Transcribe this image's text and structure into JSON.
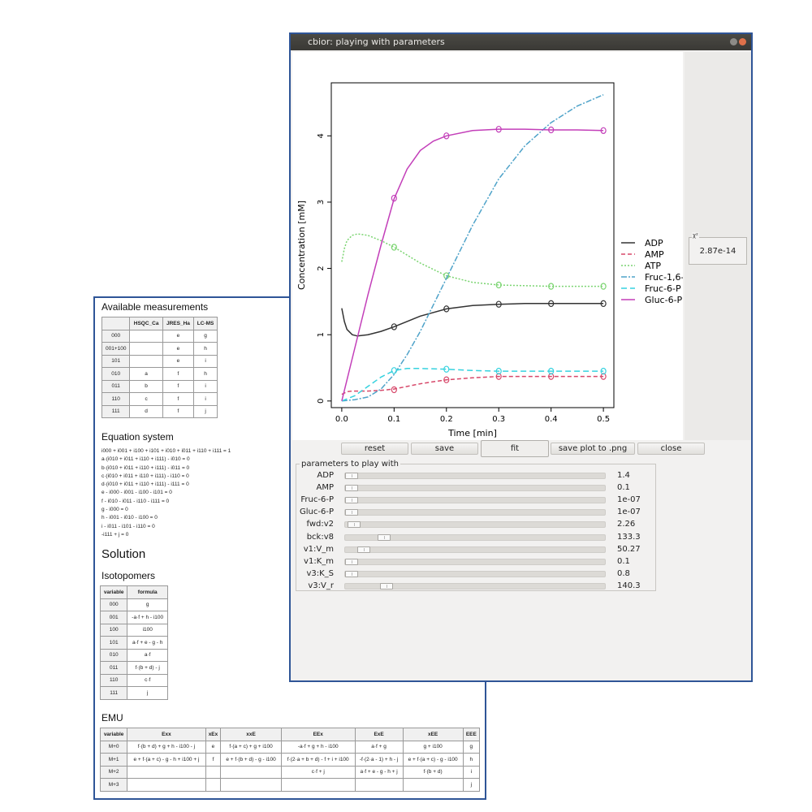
{
  "document": {
    "available_title": "Available measurements",
    "measure_headers": [
      "",
      "HSQC_Ca",
      "JRES_Ha",
      "LC-MS"
    ],
    "measure_rows": [
      [
        "000",
        "",
        "e",
        "g"
      ],
      [
        "001+100",
        "",
        "e",
        "h"
      ],
      [
        "101",
        "",
        "e",
        "i"
      ],
      [
        "010",
        "a",
        "f",
        "h"
      ],
      [
        "011",
        "b",
        "f",
        "i"
      ],
      [
        "110",
        "c",
        "f",
        "i"
      ],
      [
        "111",
        "d",
        "f",
        "j"
      ]
    ],
    "equation_title": "Equation system",
    "equations": [
      "i000 + i001 + i100 + i101 + i010 + i011 + i110 + i111 = 1",
      "a·(i010 + i011 + i110 + i111) - i010 = 0",
      "b·(i010 + i011 + i110 + i111) - i011 = 0",
      "c·(i010 + i011 + i110 + i111) - i110 = 0",
      "d·(i010 + i011 + i110 + i111) - i111 = 0",
      "e - i000 - i001 - i100 - i101 = 0",
      "f - i010 - i011 - i110 - i111 = 0",
      "g - i000 = 0",
      "h - i001 - i010 - i100 = 0",
      "i - i011 - i101 - i110 = 0",
      "-i111 + j = 0"
    ],
    "solution_title": "Solution",
    "isotopomers_title": "Isotopomers",
    "iso_headers": [
      "variable",
      "formula"
    ],
    "iso_rows": [
      [
        "000",
        "g"
      ],
      [
        "001",
        "-a·f + h - i100"
      ],
      [
        "100",
        "i100"
      ],
      [
        "101",
        "a·f + e - g - h"
      ],
      [
        "010",
        "a·f"
      ],
      [
        "011",
        "f·(b + d) - j"
      ],
      [
        "110",
        "c·f"
      ],
      [
        "111",
        "j"
      ]
    ],
    "emu_title": "EMU",
    "emu_headers": [
      "variable",
      "Exx",
      "xEx",
      "xxE",
      "EEx",
      "ExE",
      "xEE",
      "EEE"
    ],
    "emu_rows": [
      [
        "M+0",
        "f·(b + d) + g + h - i100 - j",
        "e",
        "f·(a + c) + g + i100",
        "-a·f + g + h - i100",
        "a·f + g",
        "g + i100",
        "g"
      ],
      [
        "M+1",
        "e + f·(a + c) - g - h + i100 + j",
        "f",
        "e + f·(b + d) - g - i100",
        "f·(2·a + b + d) - f + i + i100",
        "-f·(2·a - 1) + h - j",
        "e + f·(a + c) - g - i100",
        "h"
      ],
      [
        "M+2",
        "",
        "",
        "",
        "c·f + j",
        "a·f + e - g - h + j",
        "f·(b + d)",
        "i"
      ],
      [
        "M+3",
        "",
        "",
        "",
        "",
        "",
        "",
        "j"
      ]
    ]
  },
  "window": {
    "title": "cbior: playing with parameters",
    "chi_label": "χ²",
    "chi_value": "2.87e-14",
    "buttons": {
      "reset": "reset",
      "save": "save",
      "fit": "fit",
      "save_png": "save plot to .png",
      "close": "close"
    },
    "params_legend": "parameters to play with",
    "params": [
      {
        "label": "ADP",
        "value": "1.4",
        "position": 0.0
      },
      {
        "label": "AMP",
        "value": "0.1",
        "position": 0.0
      },
      {
        "label": "Fruc-6-P",
        "value": "1e-07",
        "position": 0.0
      },
      {
        "label": "Gluc-6-P",
        "value": "1e-07",
        "position": 0.0
      },
      {
        "label": "fwd:v2",
        "value": "2.26",
        "position": 0.01
      },
      {
        "label": "bck:v8",
        "value": "133.3",
        "position": 0.13
      },
      {
        "label": "v1:V_m",
        "value": "50.27",
        "position": 0.05
      },
      {
        "label": "v1:K_m",
        "value": "0.1",
        "position": 0.0
      },
      {
        "label": "v3:K_S",
        "value": "0.8",
        "position": 0.0
      },
      {
        "label": "v3:V_r",
        "value": "140.3",
        "position": 0.14
      }
    ]
  },
  "chart_data": {
    "type": "line",
    "title": "",
    "xlabel": "Time [min]",
    "ylabel": "Concentration [mM]",
    "xlim": [
      -0.02,
      0.52
    ],
    "ylim": [
      -0.1,
      4.8
    ],
    "xticks": [
      0.0,
      0.1,
      0.2,
      0.3,
      0.4,
      0.5
    ],
    "xtick_labels": [
      "0.0",
      "0.1",
      "0.2",
      "0.3",
      "0.4",
      "0.5"
    ],
    "yticks": [
      0,
      1,
      2,
      3,
      4
    ],
    "ytick_labels": [
      "0",
      "1",
      "2",
      "3",
      "4"
    ],
    "legend_position": "right",
    "series": [
      {
        "name": "ADP",
        "color": "#333333",
        "dash": "solid",
        "x": [
          0.0,
          0.005,
          0.01,
          0.02,
          0.03,
          0.05,
          0.075,
          0.1,
          0.15,
          0.2,
          0.25,
          0.3,
          0.35,
          0.4,
          0.45,
          0.5
        ],
        "y": [
          1.4,
          1.2,
          1.08,
          1.0,
          0.98,
          1.0,
          1.05,
          1.12,
          1.28,
          1.39,
          1.44,
          1.46,
          1.47,
          1.47,
          1.47,
          1.47
        ],
        "points_x": [
          0.1,
          0.2,
          0.3,
          0.4,
          0.5
        ],
        "points_y": [
          1.12,
          1.39,
          1.46,
          1.47,
          1.47
        ]
      },
      {
        "name": "AMP",
        "color": "#d7486a",
        "dash": "5,3",
        "x": [
          0.0,
          0.01,
          0.02,
          0.03,
          0.05,
          0.075,
          0.1,
          0.15,
          0.2,
          0.25,
          0.3,
          0.35,
          0.4,
          0.45,
          0.5
        ],
        "y": [
          0.1,
          0.14,
          0.15,
          0.15,
          0.15,
          0.16,
          0.18,
          0.26,
          0.32,
          0.35,
          0.37,
          0.37,
          0.37,
          0.37,
          0.37
        ],
        "points_x": [
          0.1,
          0.2,
          0.3,
          0.4,
          0.5
        ],
        "points_y": [
          0.17,
          0.32,
          0.37,
          0.37,
          0.37
        ]
      },
      {
        "name": "ATP",
        "color": "#7ad470",
        "dash": "2,2",
        "x": [
          0.0,
          0.005,
          0.01,
          0.02,
          0.03,
          0.05,
          0.075,
          0.1,
          0.15,
          0.2,
          0.25,
          0.3,
          0.35,
          0.4,
          0.45,
          0.5
        ],
        "y": [
          2.1,
          2.3,
          2.42,
          2.5,
          2.52,
          2.5,
          2.42,
          2.32,
          2.08,
          1.89,
          1.79,
          1.75,
          1.74,
          1.73,
          1.73,
          1.73
        ],
        "points_x": [
          0.1,
          0.2,
          0.3,
          0.4,
          0.5
        ],
        "points_y": [
          2.32,
          1.89,
          1.75,
          1.73,
          1.73
        ]
      },
      {
        "name": "Fruc-1,6-",
        "color": "#4fa3c9",
        "dash": "7,2,2,2",
        "x": [
          0.0,
          0.025,
          0.05,
          0.075,
          0.1,
          0.125,
          0.15,
          0.2,
          0.25,
          0.3,
          0.35,
          0.4,
          0.45,
          0.5
        ],
        "y": [
          0.0,
          0.02,
          0.06,
          0.18,
          0.4,
          0.7,
          1.05,
          1.85,
          2.65,
          3.35,
          3.85,
          4.2,
          4.45,
          4.62
        ],
        "points_x": [],
        "points_y": []
      },
      {
        "name": "Fruc-6-P",
        "color": "#36d2df",
        "dash": "7,4",
        "x": [
          0.0,
          0.025,
          0.05,
          0.075,
          0.1,
          0.125,
          0.15,
          0.2,
          0.25,
          0.3,
          0.35,
          0.4,
          0.45,
          0.5
        ],
        "y": [
          0.0,
          0.08,
          0.22,
          0.36,
          0.46,
          0.49,
          0.49,
          0.48,
          0.46,
          0.45,
          0.45,
          0.45,
          0.45,
          0.45
        ],
        "points_x": [
          0.1,
          0.2,
          0.3,
          0.4,
          0.5
        ],
        "points_y": [
          0.46,
          0.48,
          0.45,
          0.45,
          0.45
        ]
      },
      {
        "name": "Gluc-6-P",
        "color": "#c33fb9",
        "dash": "solid",
        "x": [
          0.0,
          0.025,
          0.05,
          0.075,
          0.1,
          0.125,
          0.15,
          0.175,
          0.2,
          0.25,
          0.3,
          0.35,
          0.4,
          0.45,
          0.5
        ],
        "y": [
          0.0,
          0.8,
          1.6,
          2.35,
          3.05,
          3.5,
          3.78,
          3.92,
          4.0,
          4.08,
          4.1,
          4.1,
          4.09,
          4.09,
          4.08
        ],
        "points_x": [
          0.1,
          0.2,
          0.3,
          0.4,
          0.5
        ],
        "points_y": [
          3.06,
          4.0,
          4.1,
          4.09,
          4.08
        ]
      }
    ]
  }
}
